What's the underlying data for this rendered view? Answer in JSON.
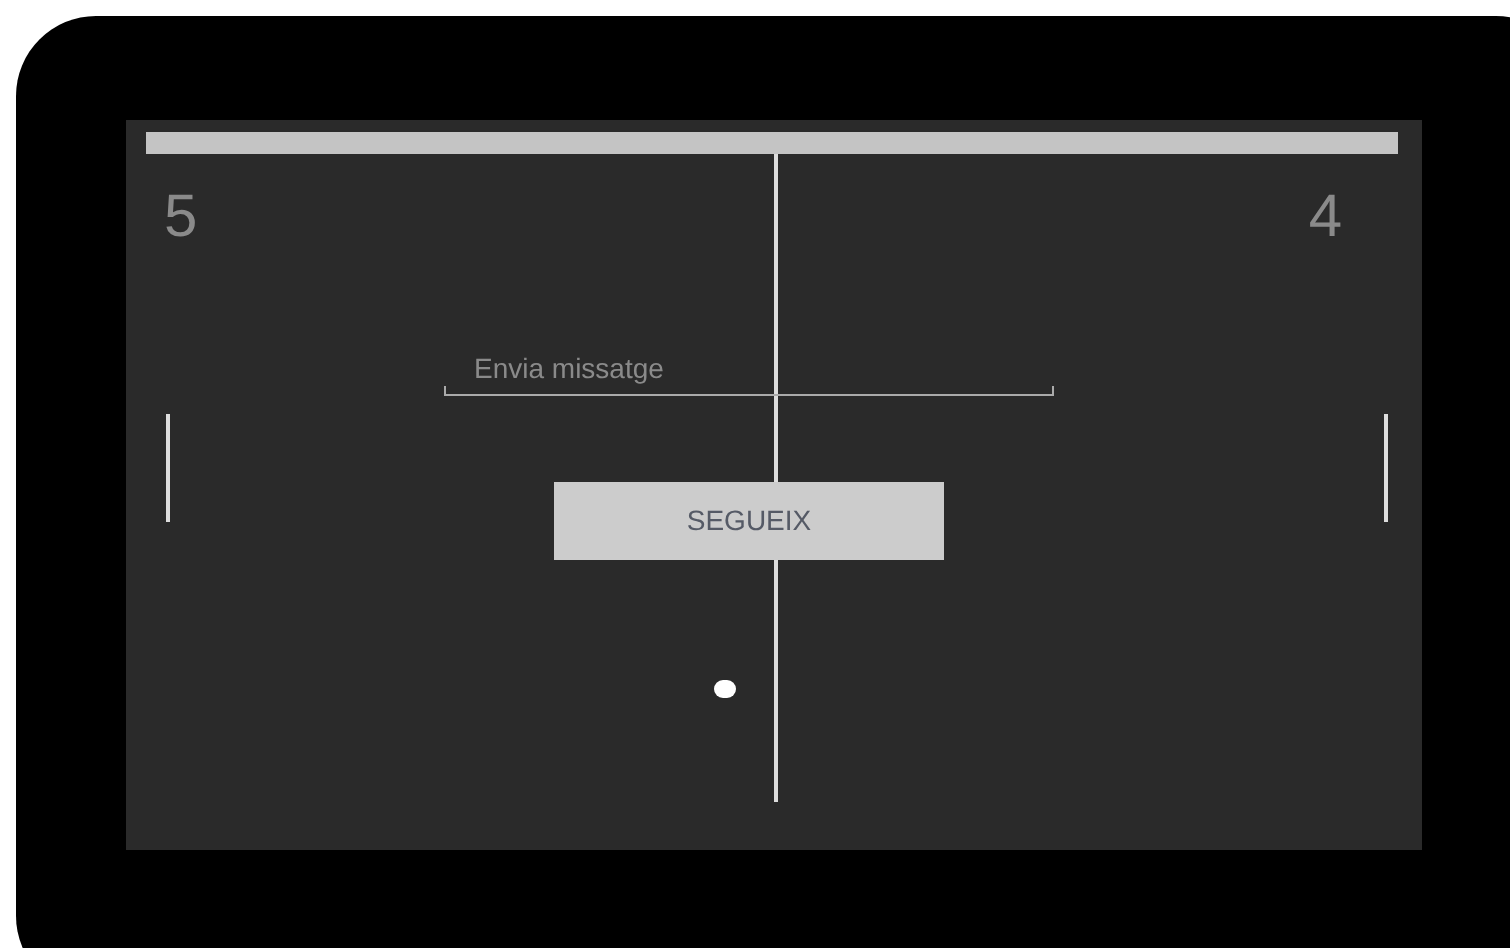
{
  "scoreboard": {
    "left_score": "5",
    "right_score": "4"
  },
  "message_field": {
    "placeholder": "Envia missatge"
  },
  "continue_button": {
    "label": "SEGUEIX"
  }
}
